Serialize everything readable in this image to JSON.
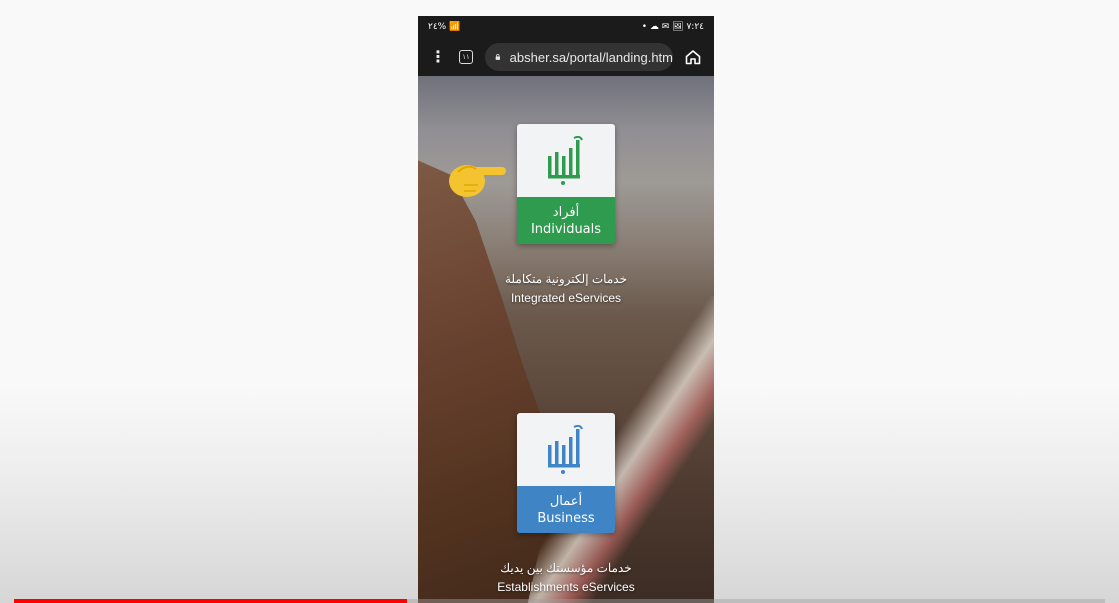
{
  "status_bar": {
    "left": "٢٤% 📶",
    "right": "• ☁ ✉ 🖼 ٧:٢٤"
  },
  "browser": {
    "tab_count": "١١",
    "url": "absher.sa/portal/landing.htm"
  },
  "page": {
    "individuals": {
      "title_ar": "أفراد",
      "title_en": "Individuals"
    },
    "individuals_caption": {
      "ar": "خدمات إلكترونية متكاملة",
      "en": "Integrated eServices"
    },
    "business": {
      "title_ar": "أعمال",
      "title_en": "Business"
    },
    "business_caption": {
      "ar": "خدمات مؤسستك بين يديك",
      "en": "Establishments eServices"
    }
  },
  "video": {
    "progress": 0.36
  },
  "colors": {
    "green": "#2e9b4f",
    "blue": "#3f85c6",
    "progress": "#ff0000"
  }
}
